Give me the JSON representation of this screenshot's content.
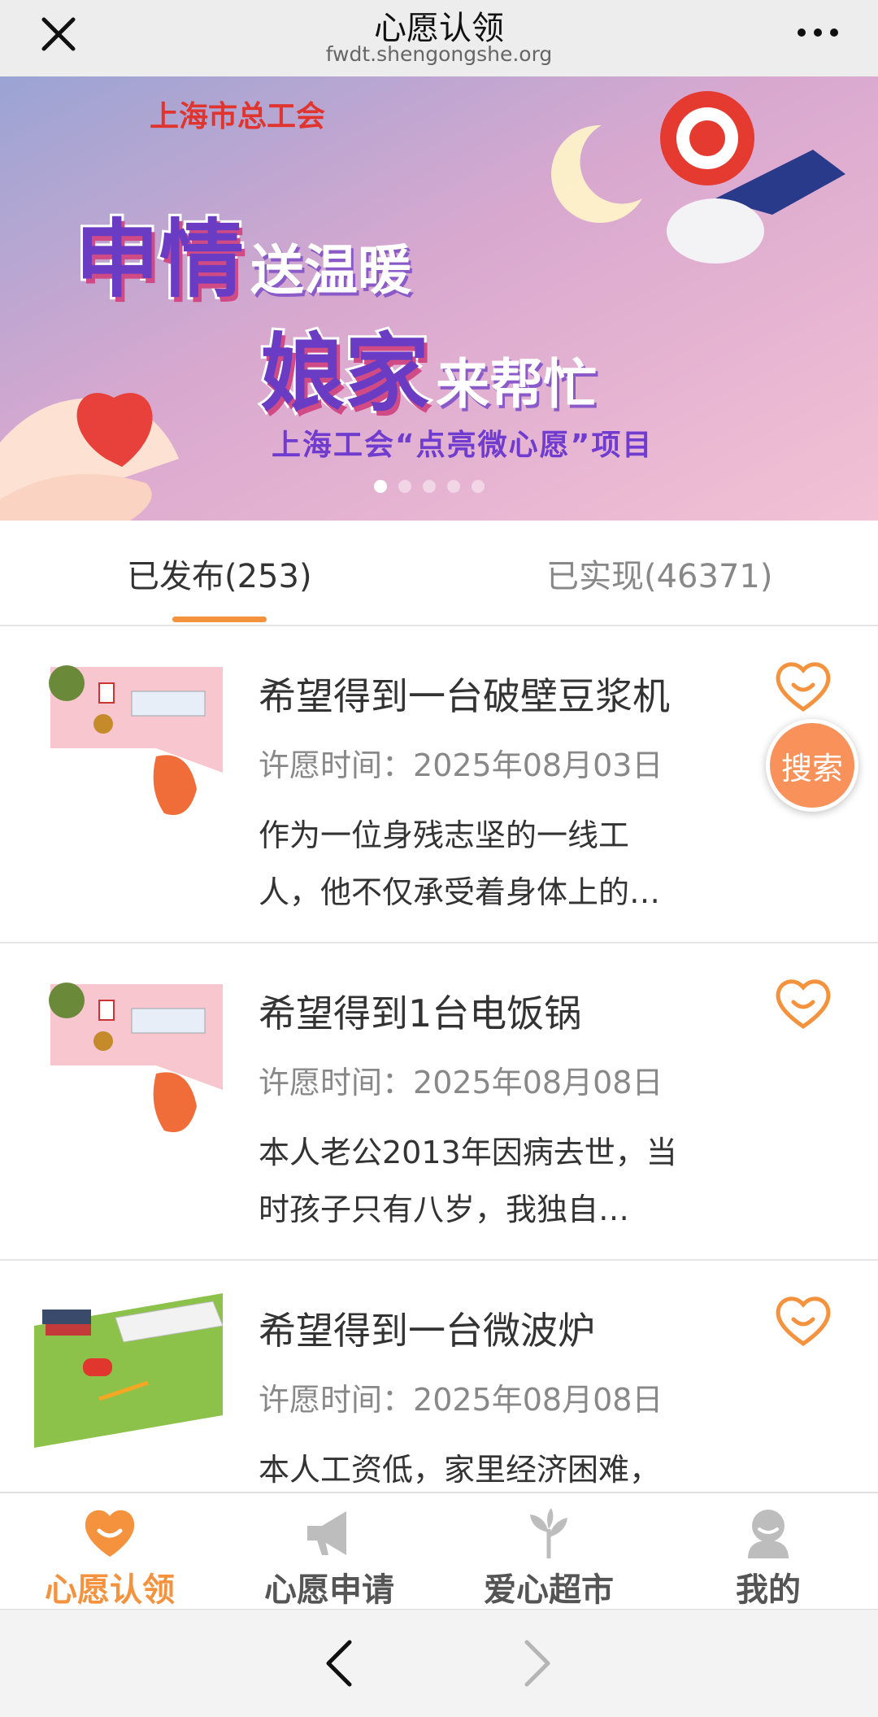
{
  "topbar": {
    "title": "心愿认领",
    "url": "fwdt.shengongshe.org"
  },
  "banner": {
    "org": "上海市总工会",
    "line1_big": "申情",
    "line1_small": "送温暖",
    "line2_big": "娘家",
    "line2_small": "来帮忙",
    "subtitle": "上海工会“点亮微心愿”项目"
  },
  "tabs": [
    {
      "label": "已发布(253)",
      "active": true
    },
    {
      "label": "已实现(46371)",
      "active": false
    }
  ],
  "wishes": [
    {
      "title": "希望得到一台破壁豆浆机",
      "date_label": "许愿时间：",
      "date": "2025年08月03日",
      "desc": "作为一位身残志坚的一线工人，他不仅承受着身体上的…"
    },
    {
      "title": "希望得到1台电饭锅",
      "date_label": "许愿时间：",
      "date": "2025年08月08日",
      "desc": "本人老公2013年因病去世，当时孩子只有八岁，我独自…"
    },
    {
      "title": "希望得到一台微波炉",
      "date_label": "许愿时间：",
      "date": "2025年08月08日",
      "desc": "本人工资低，家里经济困难，"
    }
  ],
  "search_button": "搜索",
  "bottom_nav": [
    {
      "label": "心愿认领",
      "icon": "heart-smile-icon",
      "active": true
    },
    {
      "label": "心愿申请",
      "icon": "megaphone-icon",
      "active": false
    },
    {
      "label": "爱心超市",
      "icon": "sprout-icon",
      "active": false
    },
    {
      "label": "我的",
      "icon": "user-icon",
      "active": false
    }
  ],
  "colors": {
    "accent": "#f5923e",
    "search_bg": "#f8925a",
    "banner_purple": "#6a3cc4"
  }
}
